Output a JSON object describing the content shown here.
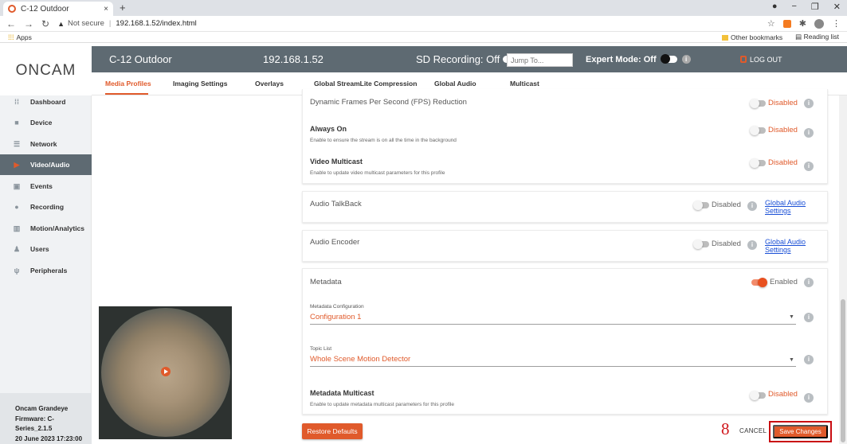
{
  "browser": {
    "tab_title": "C-12 Outdoor",
    "tab_close": "×",
    "new_tab": "+",
    "security": "Not secure",
    "url": "192.168.1.52/index.html",
    "apps": "Apps",
    "other_bookmarks": "Other bookmarks",
    "reading_list": "Reading list",
    "minimize": "−",
    "restore": "❐",
    "close": "✕"
  },
  "logo": {
    "text": "ONCAM"
  },
  "header": {
    "camera_name": "C-12 Outdoor",
    "ip": "192.168.1.52",
    "sd_recording": "SD Recording: Off",
    "jump_placeholder": "Jump To...",
    "expert_mode": "Expert Mode: Off",
    "logout": "LOG OUT"
  },
  "tabs": [
    "Media Profiles",
    "Imaging Settings",
    "Overlays",
    "Global StreamLite Compression",
    "Global Audio",
    "Multicast"
  ],
  "sidebar": {
    "items": [
      "Dashboard",
      "Device",
      "Network",
      "Video/Audio",
      "Events",
      "Recording",
      "Motion/Analytics",
      "Users",
      "Peripherals"
    ],
    "active": "Video/Audio",
    "footer": [
      "Oncam Grandeye",
      "Firmware: C-",
      "Series_2.1.5",
      "20 June 2023 17:23:00"
    ]
  },
  "settings": {
    "fps_reduction": {
      "title": "Dynamic Frames Per Second (FPS) Reduction",
      "state": "Disabled"
    },
    "always_on": {
      "title": "Always On",
      "desc": "Enable to ensure the stream is on all the time in the background",
      "state": "Disabled"
    },
    "video_multicast": {
      "title": "Video Multicast",
      "desc": "Enable to update video multicast parameters for this profile",
      "state": "Disabled"
    },
    "audio_talkback": {
      "title": "Audio TalkBack",
      "state": "Disabled",
      "link1": "Global Audio",
      "link2": "Settings"
    },
    "audio_encoder": {
      "title": "Audio Encoder",
      "state": "Disabled",
      "link1": "Global Audio",
      "link2": "Settings"
    },
    "metadata": {
      "title": "Metadata",
      "state": "Enabled",
      "config_label": "Metadata Configuration",
      "config_value": "Configuration 1",
      "topic_label": "Topic List",
      "topic_value": "Whole Scene Motion Detector",
      "multicast_title": "Metadata Multicast",
      "multicast_desc": "Enable to update metadata multicast parameters for this profile",
      "multicast_state": "Disabled"
    }
  },
  "actions": {
    "restore": "Restore Defaults",
    "annotation": "8",
    "cancel": "CANCEL",
    "save": "Save Changes"
  },
  "colors": {
    "accent": "#e05a2b",
    "header": "#5e6a72",
    "annotation": "#d0161b"
  }
}
